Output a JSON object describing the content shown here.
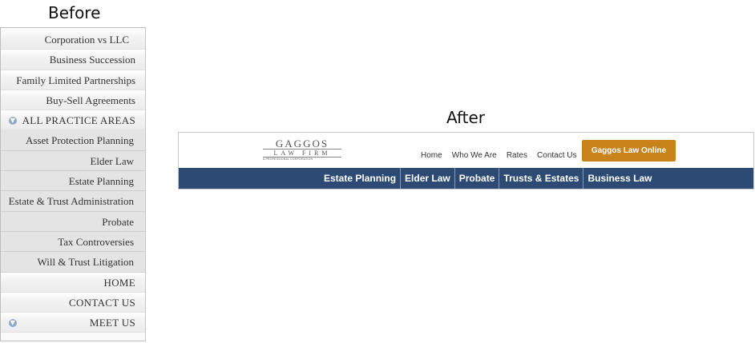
{
  "captions": {
    "before": "Before",
    "after": "After"
  },
  "before_menu": {
    "items": [
      {
        "label": "Corporation vs LLC"
      },
      {
        "label": "Business Succession"
      },
      {
        "label": "Family Limited Partnerships"
      },
      {
        "label": "Buy-Sell Agreements"
      },
      {
        "label": "ALL PRACTICE AREAS",
        "icon": "down-arrow-icon"
      },
      {
        "label": "Asset Protection Planning"
      },
      {
        "label": "Elder Law"
      },
      {
        "label": "Estate Planning"
      },
      {
        "label": "Estate & Trust Administration"
      },
      {
        "label": "Probate"
      },
      {
        "label": "Tax Controversies"
      },
      {
        "label": "Will & Trust Litigation"
      },
      {
        "label": "HOME"
      },
      {
        "label": "CONTACT US"
      },
      {
        "label": "MEET US",
        "icon": "down-arrow-icon"
      }
    ]
  },
  "after_site": {
    "logo": {
      "name": "GAGGOS",
      "sub": "LAW FIRM",
      "tagline": "A PROFESSIONAL CORPORATION"
    },
    "top_nav": [
      {
        "label": "Home"
      },
      {
        "label": "Who We Are"
      },
      {
        "label": "Rates"
      },
      {
        "label": "Contact Us"
      }
    ],
    "cta_label": "Gaggos Law Online",
    "blue_nav": [
      {
        "label": "Estate Planning"
      },
      {
        "label": "Elder Law"
      },
      {
        "label": "Probate"
      },
      {
        "label": "Trusts & Estates"
      },
      {
        "label": "Business Law"
      }
    ],
    "colors": {
      "nav_blue": "#2c4a73",
      "cta_orange": "#c8841a"
    }
  }
}
